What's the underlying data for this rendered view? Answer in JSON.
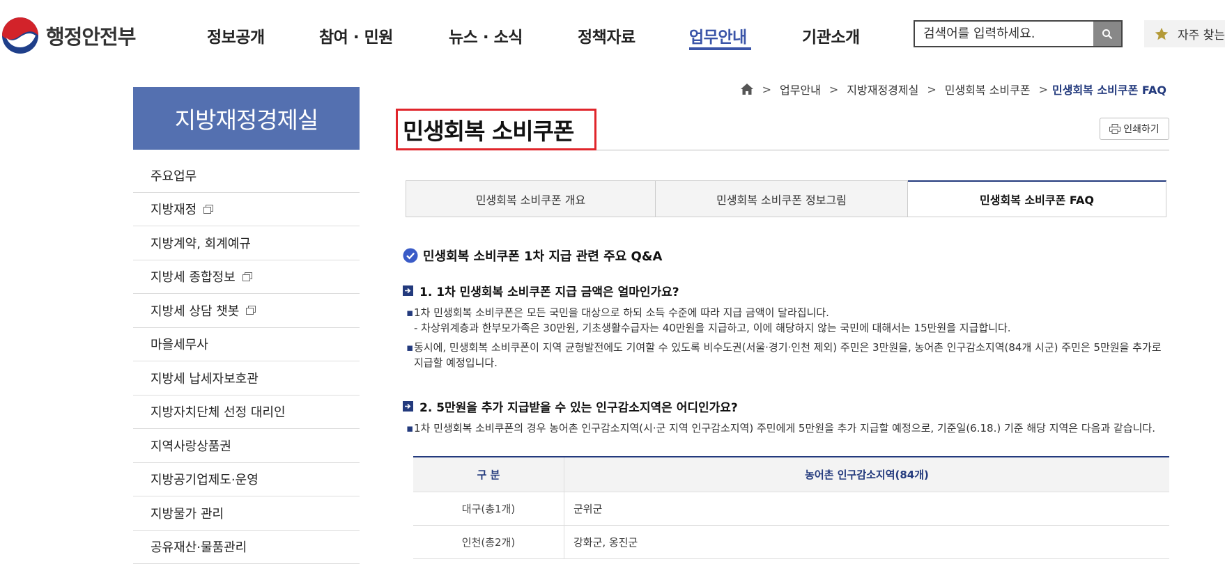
{
  "logo": {
    "text": "행정안전부"
  },
  "nav": {
    "items": [
      {
        "label": "정보공개"
      },
      {
        "label": "참여 · 민원"
      },
      {
        "label": "뉴스 · 소식"
      },
      {
        "label": "정책자료"
      },
      {
        "label": "업무안내",
        "active": true
      },
      {
        "label": "기관소개"
      }
    ]
  },
  "search": {
    "placeholder": "검색어를 입력하세요."
  },
  "favorites": {
    "label": "자주 찾는"
  },
  "sidebar": {
    "title": "지방재정경제실",
    "items": [
      {
        "label": "주요업무",
        "external": false
      },
      {
        "label": "지방재정",
        "external": true
      },
      {
        "label": "지방계약, 회계예규",
        "external": false
      },
      {
        "label": "지방세 종합정보",
        "external": true
      },
      {
        "label": "지방세 상담 챗봇",
        "external": true
      },
      {
        "label": "마을세무사",
        "external": false
      },
      {
        "label": "지방세 납세자보호관",
        "external": false
      },
      {
        "label": "지방자치단체 선정 대리인",
        "external": false
      },
      {
        "label": "지역사랑상품권",
        "external": false
      },
      {
        "label": "지방공기업제도·운영",
        "external": false
      },
      {
        "label": "지방물가 관리",
        "external": false
      },
      {
        "label": "공유재산·물품관리",
        "external": false
      }
    ]
  },
  "breadcrumb": {
    "items": [
      "업무안내",
      "지방재정경제실",
      "민생회복 소비쿠폰"
    ],
    "current": "민생회복 소비쿠폰 FAQ",
    "separator": ">"
  },
  "page": {
    "title": "민생회복 소비쿠폰",
    "print_label": "인쇄하기"
  },
  "tabs": [
    {
      "label": "민생회복 소비쿠폰 개요"
    },
    {
      "label": "민생회복 소비쿠폰 정보그림"
    },
    {
      "label": "민생회복 소비쿠폰 FAQ",
      "active": true
    }
  ],
  "content": {
    "section_title": "민생회복 소비쿠폰 1차 지급 관련 주요 Q&A",
    "q1": {
      "title": "1. 1차 민생회복 소비쿠폰 지급 금액은 얼마인가요?",
      "p1_line1": "1차 민생회복 소비쿠폰은 모든 국민을 대상으로 하되 소득 수준에 따라 지급 금액이 달라집니다.",
      "p1_line2": "- 차상위계층과 한부모가족은 30만원, 기초생활수급자는 40만원을 지급하고, 이에 해당하지 않는 국민에 대해서는 15만원을 지급합니다.",
      "p2": "동시에, 민생회복 소비쿠폰이 지역 균형발전에도 기여할 수 있도록 비수도권(서울·경기·인천 제외) 주민은 3만원을, 농어촌 인구감소지역(84개 시군) 주민은 5만원을 추가로 지급할 예정입니다."
    },
    "q2": {
      "title": "2. 5만원을 추가 지급받을 수 있는 인구감소지역은 어디인가요?",
      "p1": "1차 민생회복 소비쿠폰의 경우 농어촌 인구감소지역(시·군 지역 인구감소지역) 주민에게 5만원을 추가 지급할 예정으로, 기준일(6.18.) 기준 해당 지역은 다음과 같습니다."
    },
    "table": {
      "headers": [
        "구 분",
        "농어촌 인구감소지역(84개)"
      ],
      "rows": [
        [
          "대구(총1개)",
          "군위군"
        ],
        [
          "인천(총2개)",
          "강화군, 옹진군"
        ]
      ]
    }
  },
  "colors": {
    "primary": "#233a7d",
    "sidebar_title_bg": "#5470b0",
    "highlight_box": "#e0252b"
  }
}
